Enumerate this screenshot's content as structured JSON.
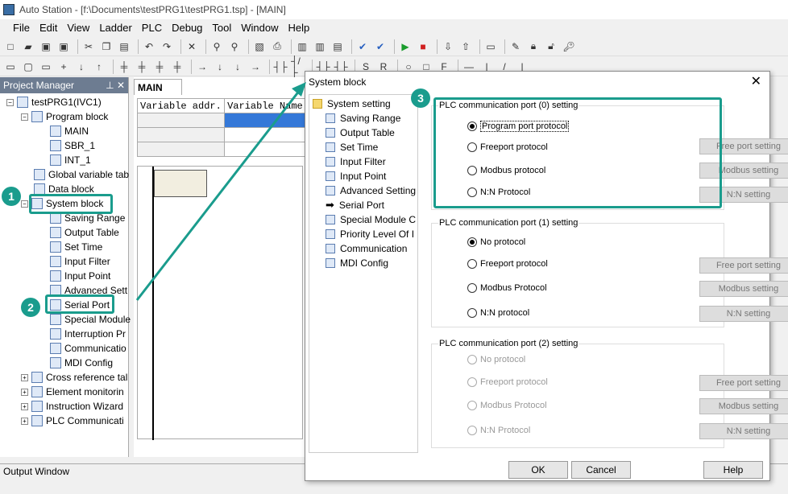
{
  "window": {
    "title": "Auto Station - [f:\\Documents\\testPRG1\\testPRG1.tsp] - [MAIN]"
  },
  "menu": [
    "File",
    "Edit",
    "View",
    "Ladder",
    "PLC",
    "Debug",
    "Tool",
    "Window",
    "Help"
  ],
  "project_manager": {
    "title": "Project Manager",
    "items": [
      "testPRG1(IVC1)",
      "Program block",
      "MAIN",
      "SBR_1",
      "INT_1",
      "Global variable tab",
      "Data block",
      "System block",
      "Saving Range",
      "Output Table",
      "Set Time",
      "Input Filter",
      "Input Point",
      "Advanced Sett",
      "Serial Port",
      "Special Module",
      "Interruption Pr",
      "Communicatio",
      "MDI Config",
      "Cross reference tal",
      "Element monitorin",
      "Instruction Wizard",
      "PLC Communicati"
    ]
  },
  "editor": {
    "tab": "MAIN",
    "col1": "Variable addr.",
    "col2": "Variable Name"
  },
  "output": {
    "label": "Output Window"
  },
  "dialog": {
    "title": "System block",
    "tree": [
      "System setting",
      "Saving Range",
      "Output Table",
      "Set Time",
      "Input Filter",
      "Input Point",
      "Advanced Setting",
      "Serial Port",
      "Special Module C",
      "Priority Level Of I",
      "Communication",
      "MDI Config"
    ],
    "groups": [
      {
        "title": "PLC communication port (0) setting",
        "options": [
          "Program port protocol",
          "Freeport protocol",
          "Modbus protocol",
          "N:N Protocol"
        ],
        "buttons": [
          "Free port setting",
          "Modbus setting",
          "N:N setting"
        ]
      },
      {
        "title": "PLC communication port (1) setting",
        "options": [
          "No protocol",
          "Freeport protocol",
          "Modbus Protocol",
          "N:N protocol"
        ],
        "buttons": [
          "Free port setting",
          "Modbus setting",
          "N:N setting"
        ]
      },
      {
        "title": "PLC communication port (2) setting",
        "options": [
          "No protocol",
          "Freeport protocol",
          "Modbus Protocol",
          "N:N Protocol"
        ],
        "buttons": [
          "Free port setting",
          "Modbus setting",
          "N:N setting"
        ]
      }
    ],
    "ok": "OK",
    "cancel": "Cancel",
    "help": "Help"
  },
  "callouts": [
    "1",
    "2",
    "3"
  ],
  "colors": {
    "accent": "#1a9c8d",
    "panel_header": "#6d7c91"
  }
}
